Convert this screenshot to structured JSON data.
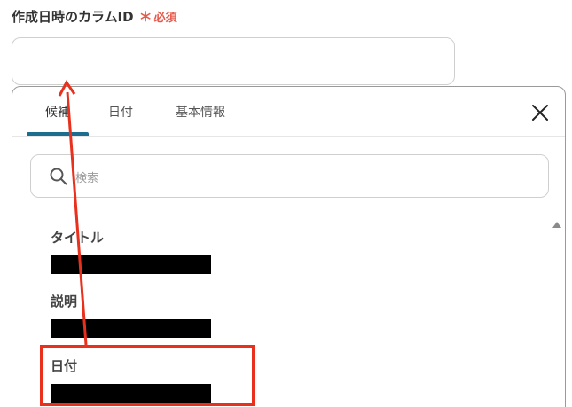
{
  "field": {
    "label": "作成日時のカラムID",
    "required_mark": "＊",
    "required_text": "必須",
    "input_value": ""
  },
  "picker": {
    "tabs": [
      {
        "label": "候補",
        "active": true
      },
      {
        "label": "日付",
        "active": false
      },
      {
        "label": "基本情報",
        "active": false
      }
    ],
    "close_icon": "close-icon",
    "search": {
      "placeholder": "検索",
      "icon": "search-icon"
    },
    "items": [
      {
        "label": "タイトル",
        "value_redacted": true
      },
      {
        "label": "説明",
        "value_redacted": true
      },
      {
        "label": "日付",
        "value_redacted": true
      }
    ]
  },
  "colors": {
    "accent": "#1d6e8e",
    "required": "#e8584a",
    "annotation": "#e8301c"
  }
}
